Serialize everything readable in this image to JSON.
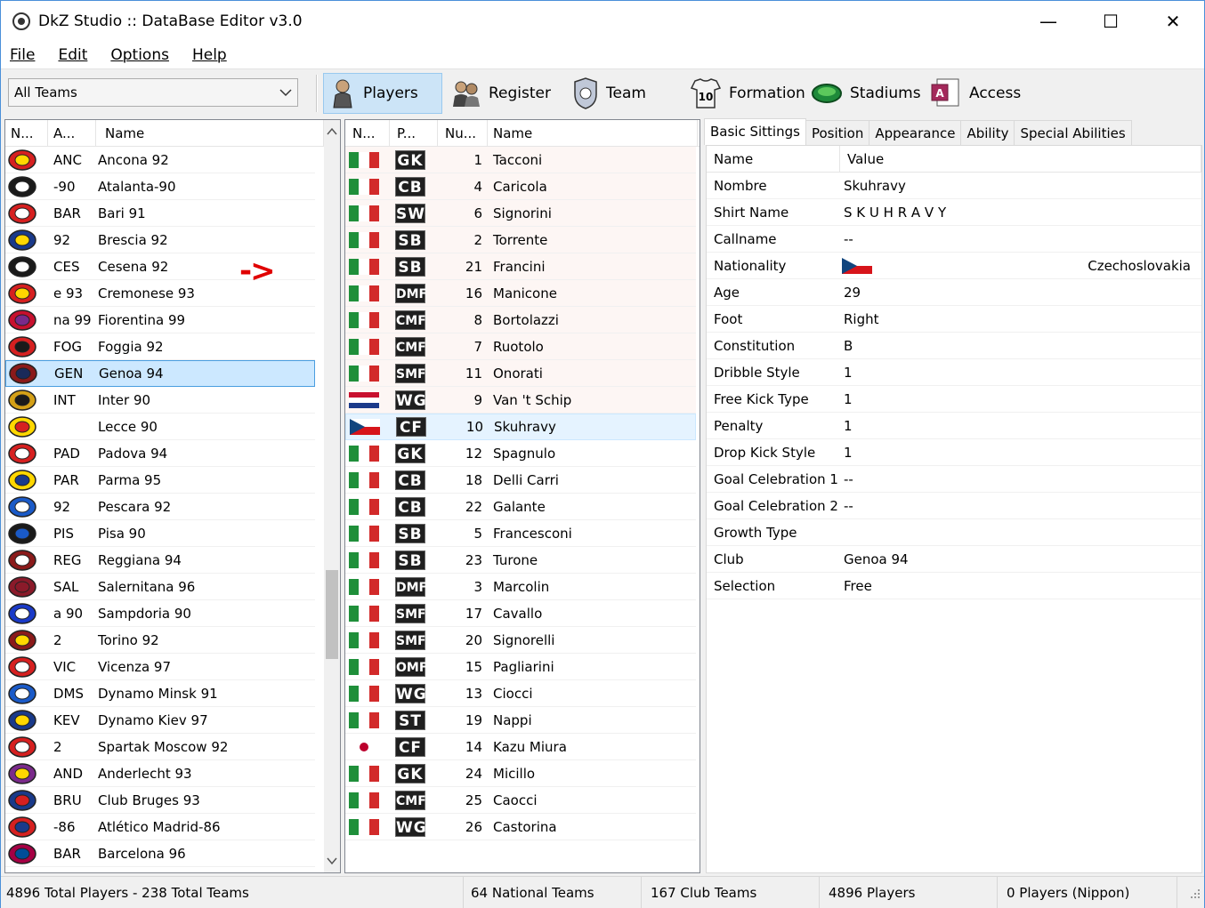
{
  "window": {
    "title": "DkZ Studio :: DataBase Editor v3.0",
    "minimize": "—",
    "maximize": "☐",
    "close": "✕"
  },
  "menu": [
    {
      "label": "File"
    },
    {
      "label": "Edit"
    },
    {
      "label": "Options"
    },
    {
      "label": "Help"
    }
  ],
  "toolbar": {
    "combo_value": "All Teams",
    "buttons": [
      {
        "label": "Players",
        "icon": "player-icon"
      },
      {
        "label": "Register",
        "icon": "register-icon"
      },
      {
        "label": "Team",
        "icon": "team-icon"
      },
      {
        "label": "Formation",
        "icon": "formation-icon"
      },
      {
        "label": "Stadiums",
        "icon": "stadium-icon"
      },
      {
        "label": "Access",
        "icon": "access-icon"
      }
    ]
  },
  "teams": {
    "columns": [
      "N...",
      "A...",
      "Name"
    ],
    "selected_index": 8,
    "rows": [
      {
        "abbr": "ANC",
        "name": "Ancona 92",
        "c1": "#d62020",
        "c2": "#ffd700"
      },
      {
        "abbr": "-90",
        "name": "Atalanta-90",
        "c1": "#1a1a1a",
        "c2": "#ffffff"
      },
      {
        "abbr": "BAR",
        "name": "Bari 91",
        "c1": "#d62020",
        "c2": "#ffffff"
      },
      {
        "abbr": "92",
        "name": "Brescia 92",
        "c1": "#1a3a8a",
        "c2": "#ffd700"
      },
      {
        "abbr": "CES",
        "name": "Cesena 92",
        "c1": "#1a1a1a",
        "c2": "#ffffff"
      },
      {
        "abbr": "e 93",
        "name": "Cremonese 93",
        "c1": "#d62020",
        "c2": "#ffd700"
      },
      {
        "abbr": "na 99",
        "name": "Fiorentina 99",
        "c1": "#c8102e",
        "c2": "#7a2a8a"
      },
      {
        "abbr": "FOG",
        "name": "Foggia 92",
        "c1": "#d62020",
        "c2": "#1a1a1a"
      },
      {
        "abbr": "GEN",
        "name": "Genoa 94",
        "c1": "#8b1a1a",
        "c2": "#1a2a5a"
      },
      {
        "abbr": "INT",
        "name": "Inter 90",
        "c1": "#d4a017",
        "c2": "#1a1a1a"
      },
      {
        "abbr": "",
        "name": "Lecce 90",
        "c1": "#ffd700",
        "c2": "#d62020"
      },
      {
        "abbr": "PAD",
        "name": "Padova 94",
        "c1": "#d62020",
        "c2": "#ffffff"
      },
      {
        "abbr": "PAR",
        "name": "Parma 95",
        "c1": "#ffd700",
        "c2": "#1a3a8a"
      },
      {
        "abbr": "92",
        "name": "Pescara 92",
        "c1": "#1a5ac8",
        "c2": "#ffffff"
      },
      {
        "abbr": "PIS",
        "name": "Pisa 90",
        "c1": "#1a1a1a",
        "c2": "#1a5ac8"
      },
      {
        "abbr": "REG",
        "name": "Reggiana 94",
        "c1": "#8b1a1a",
        "c2": "#ffffff"
      },
      {
        "abbr": "SAL",
        "name": "Salernitana 96",
        "c1": "#8b1a2a",
        "c2": "#8b1a2a"
      },
      {
        "abbr": "a 90",
        "name": "Sampdoria 90",
        "c1": "#1a3ac8",
        "c2": "#ffffff"
      },
      {
        "abbr": "2",
        "name": "Torino 92",
        "c1": "#8b1a1a",
        "c2": "#ffd700"
      },
      {
        "abbr": "VIC",
        "name": "Vicenza 97",
        "c1": "#d62020",
        "c2": "#ffffff"
      },
      {
        "abbr": "DMS",
        "name": "Dynamo Minsk 91",
        "c1": "#1a5ac8",
        "c2": "#ffffff"
      },
      {
        "abbr": "KEV",
        "name": "Dynamo Kiev 97",
        "c1": "#1a3a8a",
        "c2": "#ffd700"
      },
      {
        "abbr": "2",
        "name": "Spartak Moscow 92",
        "c1": "#d62020",
        "c2": "#ffffff"
      },
      {
        "abbr": "AND",
        "name": "Anderlecht 93",
        "c1": "#7a2a8a",
        "c2": "#ffd700"
      },
      {
        "abbr": "BRU",
        "name": "Club Bruges 93",
        "c1": "#1a3a8a",
        "c2": "#d62020"
      },
      {
        "abbr": "-86",
        "name": "Atlético Madrid-86",
        "c1": "#d62020",
        "c2": "#1a3a8a"
      },
      {
        "abbr": "BAR",
        "name": "Barcelona 96",
        "c1": "#a50044",
        "c2": "#004d98"
      }
    ]
  },
  "arrow": "->",
  "players": {
    "columns": [
      "N...",
      "P...",
      "Nu...",
      "Name"
    ],
    "selected_index": 10,
    "rows": [
      {
        "flag": "it",
        "pos": "GK",
        "num": "1",
        "name": "Tacconi"
      },
      {
        "flag": "it",
        "pos": "CB",
        "num": "4",
        "name": "Caricola"
      },
      {
        "flag": "it",
        "pos": "SW",
        "num": "6",
        "name": "Signorini"
      },
      {
        "flag": "it",
        "pos": "SB",
        "num": "2",
        "name": "Torrente"
      },
      {
        "flag": "it",
        "pos": "SB",
        "num": "21",
        "name": "Francini"
      },
      {
        "flag": "it",
        "pos": "DMF",
        "num": "16",
        "name": "Manicone"
      },
      {
        "flag": "it",
        "pos": "CMF",
        "num": "8",
        "name": "Bortolazzi"
      },
      {
        "flag": "it",
        "pos": "CMF",
        "num": "7",
        "name": "Ruotolo"
      },
      {
        "flag": "it",
        "pos": "SMF",
        "num": "11",
        "name": "Onorati"
      },
      {
        "flag": "nl",
        "pos": "WG",
        "num": "9",
        "name": "Van 't Schip"
      },
      {
        "flag": "cz",
        "pos": "CF",
        "num": "10",
        "name": "Skuhravy"
      },
      {
        "flag": "it",
        "pos": "GK",
        "num": "12",
        "name": "Spagnulo"
      },
      {
        "flag": "it",
        "pos": "CB",
        "num": "18",
        "name": "Delli Carri"
      },
      {
        "flag": "it",
        "pos": "CB",
        "num": "22",
        "name": "Galante"
      },
      {
        "flag": "it",
        "pos": "SB",
        "num": "5",
        "name": "Francesconi"
      },
      {
        "flag": "it",
        "pos": "SB",
        "num": "23",
        "name": "Turone"
      },
      {
        "flag": "it",
        "pos": "DMF",
        "num": "3",
        "name": "Marcolin"
      },
      {
        "flag": "it",
        "pos": "SMF",
        "num": "17",
        "name": "Cavallo"
      },
      {
        "flag": "it",
        "pos": "SMF",
        "num": "20",
        "name": "Signorelli"
      },
      {
        "flag": "it",
        "pos": "OMF",
        "num": "15",
        "name": "Pagliarini"
      },
      {
        "flag": "it",
        "pos": "WG",
        "num": "13",
        "name": "Ciocci"
      },
      {
        "flag": "it",
        "pos": "ST",
        "num": "19",
        "name": "Nappi"
      },
      {
        "flag": "jp",
        "pos": "CF",
        "num": "14",
        "name": "Kazu Miura"
      },
      {
        "flag": "it",
        "pos": "GK",
        "num": "24",
        "name": "Micillo"
      },
      {
        "flag": "it",
        "pos": "CMF",
        "num": "25",
        "name": "Caocci"
      },
      {
        "flag": "it",
        "pos": "WG",
        "num": "26",
        "name": "Castorina"
      }
    ]
  },
  "detail": {
    "tabs": [
      "Basic Sittings",
      "Position",
      "Appearance",
      "Ability",
      "Special Abilities"
    ],
    "columns": [
      "Name",
      "Value"
    ],
    "rows": [
      {
        "key": "Nombre",
        "value": "Skuhravy"
      },
      {
        "key": "Shirt Name",
        "value": "S K U H R A V Y"
      },
      {
        "key": "Callname",
        "value": "--"
      },
      {
        "key": "Nationality",
        "value": "Czechoslovakia",
        "flag": "cz"
      },
      {
        "key": "Age",
        "value": "29"
      },
      {
        "key": "Foot",
        "value": "Right"
      },
      {
        "key": "Constitution",
        "value": "B"
      },
      {
        "key": "Dribble Style",
        "value": "1"
      },
      {
        "key": "Free Kick Type",
        "value": "1"
      },
      {
        "key": "Penalty",
        "value": "1"
      },
      {
        "key": "Drop Kick Style",
        "value": "1"
      },
      {
        "key": "Goal Celebration 1",
        "value": "--"
      },
      {
        "key": "Goal Celebration 2",
        "value": "--"
      },
      {
        "key": "Growth Type",
        "value": ""
      },
      {
        "key": "Club",
        "value": "Genoa 94"
      },
      {
        "key": "Selection",
        "value": "Free"
      }
    ]
  },
  "status": [
    {
      "text": "4896 Total Players  -  238 Total Teams"
    },
    {
      "text": "64 National Teams"
    },
    {
      "text": "167 Club Teams"
    },
    {
      "text": "4896 Players"
    },
    {
      "text": "0 Players (Nippon)"
    }
  ]
}
